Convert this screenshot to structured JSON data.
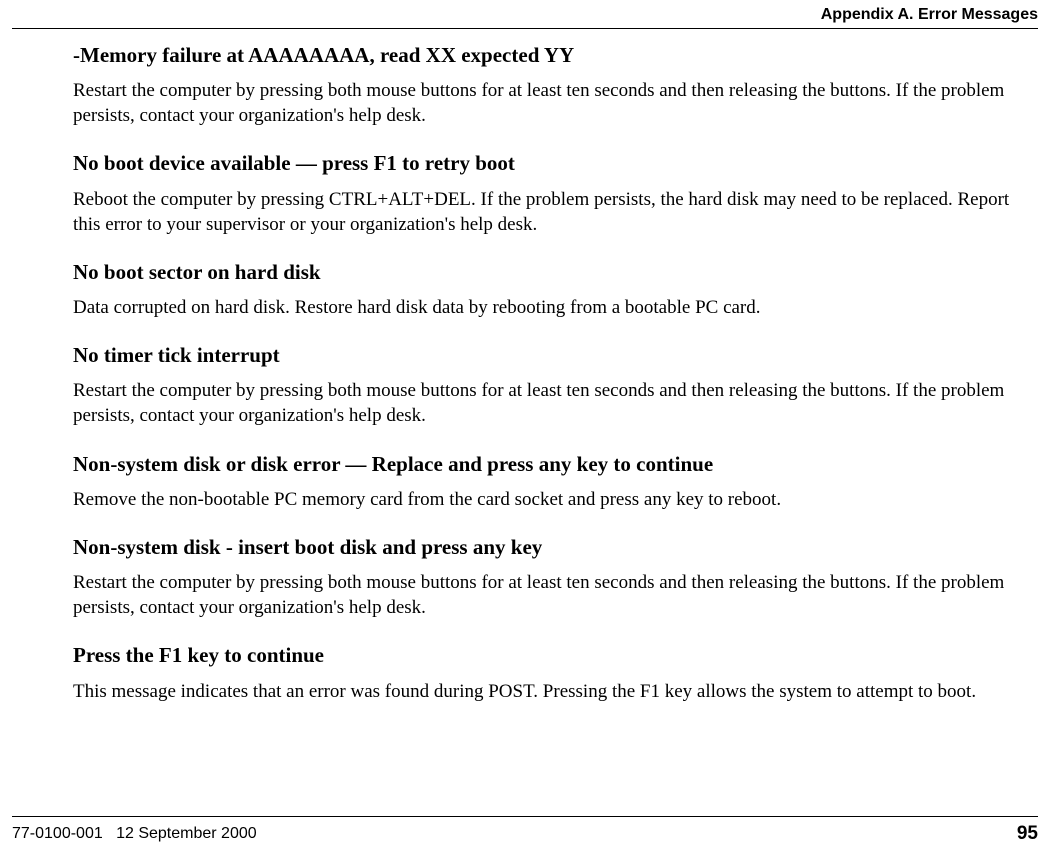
{
  "header": {
    "title": "Appendix A. Error Messages"
  },
  "entries": [
    {
      "heading": "-Memory failure at AAAAAAAA, read XX expected YY",
      "body": "Restart the computer by pressing both mouse buttons for at least ten seconds and then releasing the buttons. If the problem persists, contact your organization's help desk."
    },
    {
      "heading": "No boot device available — press F1 to retry boot",
      "body": "Reboot the computer by pressing CTRL+ALT+DEL. If the problem persists, the hard disk may need to be replaced. Report this error to your supervisor or your organization's help desk."
    },
    {
      "heading": "No boot sector on hard disk",
      "body": "Data corrupted on hard disk. Restore hard disk data by rebooting from a bootable PC card."
    },
    {
      "heading": "No timer tick interrupt",
      "body": "Restart the computer by pressing both mouse buttons for at least ten seconds and then releasing the buttons. If the problem persists, contact your organization's help desk."
    },
    {
      "heading": "Non-system disk or disk error — Replace and press any key to continue",
      "body": "Remove the non-bootable PC memory card from the card socket and press any key to reboot."
    },
    {
      "heading": "Non-system disk - insert boot disk and press any key",
      "body": "Restart the computer by pressing both mouse buttons for at least ten seconds and then releasing the buttons. If the problem persists, contact your organization's help desk."
    },
    {
      "heading": "Press the F1 key to continue",
      "body": "This message indicates that an error was found during POST. Pressing the F1 key allows the system to attempt to boot."
    }
  ],
  "footer": {
    "doc_id": "77-0100-001",
    "date": "12 September 2000",
    "page": "95"
  }
}
